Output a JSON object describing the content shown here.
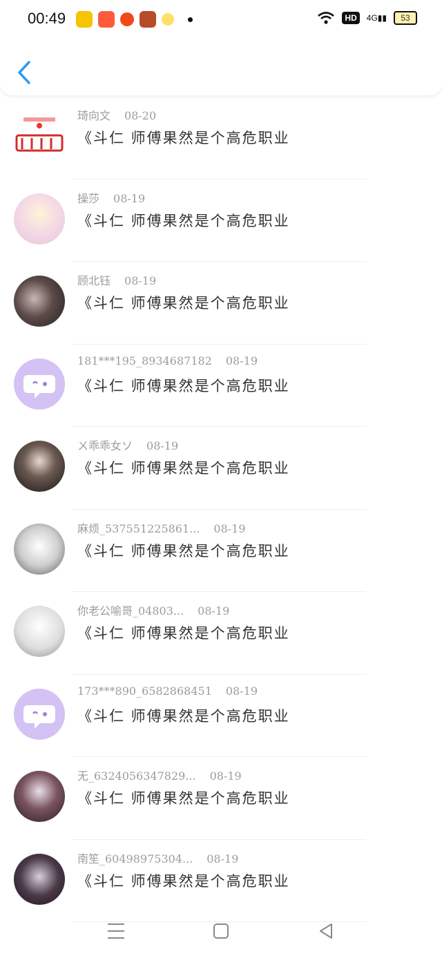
{
  "status_bar": {
    "time": "00:49",
    "hd": "HD",
    "signal": "4G",
    "battery": "53"
  },
  "comments": [
    {
      "user": "琦向文",
      "date": "08-20",
      "text": "《斗仁 师傅果然是个高危职业",
      "avatar": "logo"
    },
    {
      "user": "操莎",
      "date": "08-19",
      "text": "《斗仁 师傅果然是个高危职业",
      "avatar": "anime-girl"
    },
    {
      "user": "顾北钰",
      "date": "08-19",
      "text": "《斗仁 师傅果然是个高危职业",
      "avatar": "dark-couple"
    },
    {
      "user": "181***195_8934687182",
      "date": "08-19",
      "text": "《斗仁 师傅果然是个高危职业",
      "avatar": "default-chat"
    },
    {
      "user": "ㄨ乖乖女ソ",
      "date": "08-19",
      "text": "《斗仁 师傅果然是个高危职业",
      "avatar": "photo-girl"
    },
    {
      "user": "麻烦_537551225861...",
      "date": "08-19",
      "text": "《斗仁 师傅果然是个高危职业",
      "avatar": "sketch-boy"
    },
    {
      "user": "你老公喻哥_04803...",
      "date": "08-19",
      "text": "《斗仁 师傅果然是个高危职业",
      "avatar": "sketch-white"
    },
    {
      "user": "173***890_6582868451",
      "date": "08-19",
      "text": "《斗仁 师傅果然是个高危职业",
      "avatar": "default-chat"
    },
    {
      "user": "无_6324056347829...",
      "date": "08-19",
      "text": "《斗仁 师傅果然是个高危职业",
      "avatar": "anime-dark"
    },
    {
      "user": "南笙_60498975304...",
      "date": "08-19",
      "text": "《斗仁 师傅果然是个高危职业",
      "avatar": "anime-pair"
    }
  ],
  "colors": {
    "accent": "#2e9bf0",
    "default_avatar": "#d3c2f3"
  }
}
